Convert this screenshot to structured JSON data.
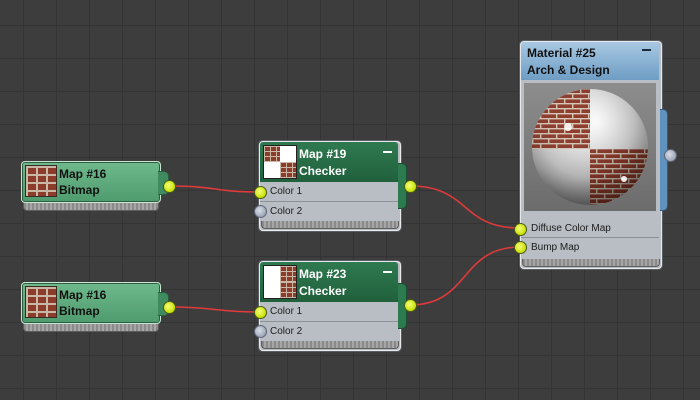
{
  "nodes": {
    "bitmap_top": {
      "title": "Map #16",
      "subtitle": "Bitmap"
    },
    "bitmap_bottom": {
      "title": "Map #16",
      "subtitle": "Bitmap"
    },
    "checker_top": {
      "title": "Map #19",
      "subtitle": "Checker",
      "slots": [
        "Color 1",
        "Color 2"
      ]
    },
    "checker_bottom": {
      "title": "Map #23",
      "subtitle": "Checker",
      "slots": [
        "Color 1",
        "Color 2"
      ]
    },
    "material": {
      "title": "Material #25",
      "subtitle": "Arch & Design",
      "slots": [
        "Diffuse Color Map",
        "Bump Map"
      ]
    }
  },
  "colors": {
    "canvas": "#3d3d3d",
    "wire": "#e03a3a",
    "socket_active": "#c8e000",
    "socket_inactive": "#9ea7b8",
    "map_node": "#5aa77a",
    "checker_header": "#2a6e47",
    "material_header": "#8fb4d6"
  }
}
